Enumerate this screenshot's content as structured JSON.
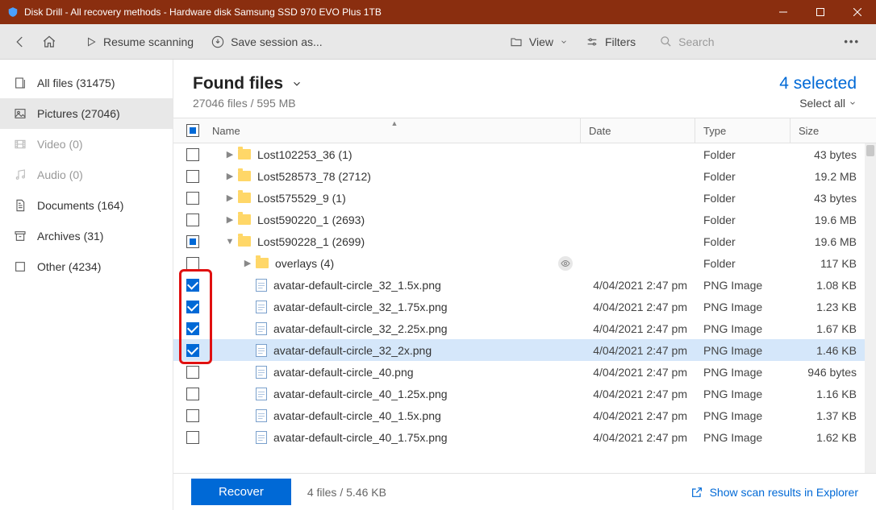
{
  "titlebar": {
    "title": "Disk Drill - All recovery methods - Hardware disk Samsung SSD 970 EVO Plus 1TB"
  },
  "toolbar": {
    "resume_label": "Resume scanning",
    "save_session_label": "Save session as...",
    "view_label": "View",
    "filters_label": "Filters",
    "search_placeholder": "Search"
  },
  "sidebar": {
    "items": [
      {
        "label": "All files (31475)"
      },
      {
        "label": "Pictures (27046)"
      },
      {
        "label": "Video (0)"
      },
      {
        "label": "Audio (0)"
      },
      {
        "label": "Documents (164)"
      },
      {
        "label": "Archives (31)"
      },
      {
        "label": "Other (4234)"
      }
    ]
  },
  "header": {
    "title": "Found files",
    "subtitle": "27046 files / 595 MB",
    "selected_text": "4 selected",
    "select_all_label": "Select all"
  },
  "columns": {
    "name": "Name",
    "date": "Date",
    "type": "Type",
    "size": "Size"
  },
  "rows": [
    {
      "check": "empty",
      "indent": 0,
      "disclosure": "right",
      "kind": "folder",
      "name": "Lost102253_36 (1)",
      "date": "",
      "type": "Folder",
      "size": "43 bytes"
    },
    {
      "check": "empty",
      "indent": 0,
      "disclosure": "right",
      "kind": "folder",
      "name": "Lost528573_78 (2712)",
      "date": "",
      "type": "Folder",
      "size": "19.2 MB"
    },
    {
      "check": "empty",
      "indent": 0,
      "disclosure": "right",
      "kind": "folder",
      "name": "Lost575529_9 (1)",
      "date": "",
      "type": "Folder",
      "size": "43 bytes"
    },
    {
      "check": "empty",
      "indent": 0,
      "disclosure": "right",
      "kind": "folder",
      "name": "Lost590220_1 (2693)",
      "date": "",
      "type": "Folder",
      "size": "19.6 MB"
    },
    {
      "check": "indet",
      "indent": 0,
      "disclosure": "down",
      "kind": "folder",
      "name": "Lost590228_1 (2699)",
      "date": "",
      "type": "Folder",
      "size": "19.6 MB"
    },
    {
      "check": "empty",
      "indent": 1,
      "disclosure": "right",
      "kind": "folder",
      "name": "overlays (4)",
      "date": "",
      "type": "Folder",
      "size": "117 KB",
      "eye": true
    },
    {
      "check": "checked",
      "indent": 1,
      "disclosure": "",
      "kind": "file",
      "name": "avatar-default-circle_32_1.5x.png",
      "date": "4/04/2021 2:47 pm",
      "type": "PNG Image",
      "size": "1.08 KB"
    },
    {
      "check": "checked",
      "indent": 1,
      "disclosure": "",
      "kind": "file",
      "name": "avatar-default-circle_32_1.75x.png",
      "date": "4/04/2021 2:47 pm",
      "type": "PNG Image",
      "size": "1.23 KB"
    },
    {
      "check": "checked",
      "indent": 1,
      "disclosure": "",
      "kind": "file",
      "name": "avatar-default-circle_32_2.25x.png",
      "date": "4/04/2021 2:47 pm",
      "type": "PNG Image",
      "size": "1.67 KB"
    },
    {
      "check": "checked",
      "indent": 1,
      "disclosure": "",
      "kind": "file",
      "name": "avatar-default-circle_32_2x.png",
      "date": "4/04/2021 2:47 pm",
      "type": "PNG Image",
      "size": "1.46 KB",
      "selected": true
    },
    {
      "check": "empty",
      "indent": 1,
      "disclosure": "",
      "kind": "file",
      "name": "avatar-default-circle_40.png",
      "date": "4/04/2021 2:47 pm",
      "type": "PNG Image",
      "size": "946 bytes"
    },
    {
      "check": "empty",
      "indent": 1,
      "disclosure": "",
      "kind": "file",
      "name": "avatar-default-circle_40_1.25x.png",
      "date": "4/04/2021 2:47 pm",
      "type": "PNG Image",
      "size": "1.16 KB"
    },
    {
      "check": "empty",
      "indent": 1,
      "disclosure": "",
      "kind": "file",
      "name": "avatar-default-circle_40_1.5x.png",
      "date": "4/04/2021 2:47 pm",
      "type": "PNG Image",
      "size": "1.37 KB"
    },
    {
      "check": "empty",
      "indent": 1,
      "disclosure": "",
      "kind": "file",
      "name": "avatar-default-circle_40_1.75x.png",
      "date": "4/04/2021 2:47 pm",
      "type": "PNG Image",
      "size": "1.62 KB"
    }
  ],
  "footer": {
    "recover_label": "Recover",
    "info": "4 files / 5.46 KB",
    "link_label": "Show scan results in Explorer"
  }
}
